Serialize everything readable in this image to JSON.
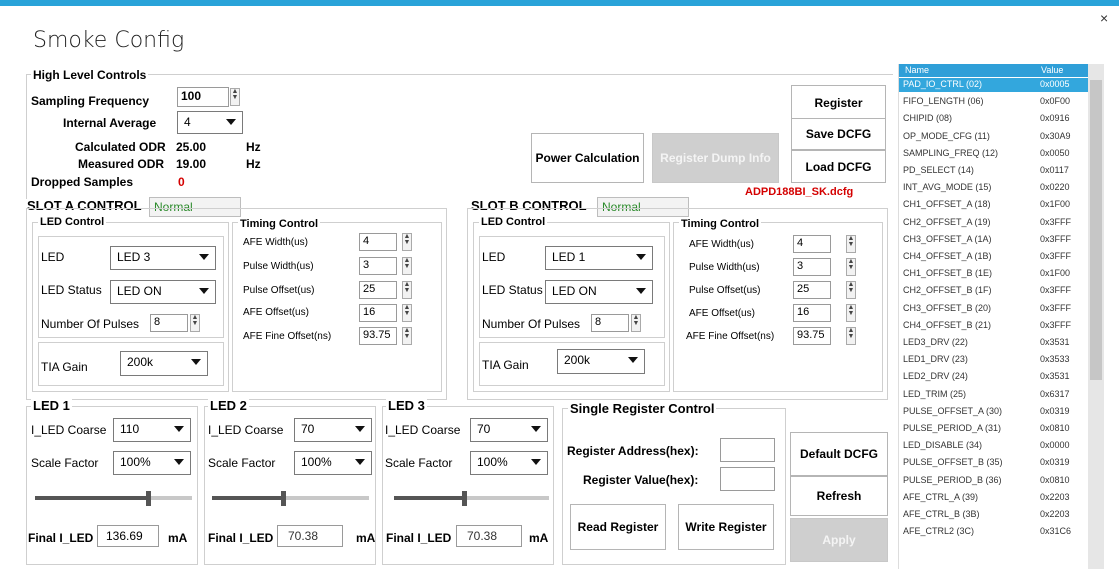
{
  "window": {
    "title": "Smoke Config",
    "close_glyph": "×",
    "accent_color": "#29a3d9"
  },
  "high_level": {
    "group_label": "High Level Controls",
    "sampling_frequency_label": "Sampling Frequency",
    "sampling_frequency_value": "100",
    "internal_average_label": "Internal Average",
    "internal_average_value": "4",
    "calculated_odr_label": "Calculated ODR",
    "calculated_odr_value": "25.00",
    "calculated_odr_unit": "Hz",
    "measured_odr_label": "Measured ODR",
    "measured_odr_value": "19.00",
    "measured_odr_unit": "Hz",
    "dropped_samples_label": "Dropped Samples",
    "dropped_samples_value": "0"
  },
  "buttons": {
    "power_calculation": "Power Calculation",
    "register_dump_info": "Register Dump Info",
    "register": "Register",
    "save_dcfg": "Save DCFG",
    "load_dcfg": "Load DCFG",
    "default_dcfg": "Default DCFG",
    "refresh": "Refresh",
    "apply": "Apply"
  },
  "dcfg_file": "ADPD188BI_SK.dcfg",
  "slot_a": {
    "title": "SLOT A CONTROL",
    "status": "Normal",
    "led_control_label": "LED Control",
    "led_label": "LED",
    "led_value": "LED 3",
    "led_status_label": "LED Status",
    "led_status_value": "LED ON",
    "pulses_label": "Number Of Pulses",
    "pulses_value": "8",
    "tia_gain_label": "TIA Gain",
    "tia_gain_value": "200k",
    "timing_label": "Timing Control",
    "afe_width_label": "AFE Width(us)",
    "afe_width_value": "4",
    "pulse_width_label": "Pulse Width(us)",
    "pulse_width_value": "3",
    "pulse_offset_label": "Pulse Offset(us)",
    "pulse_offset_value": "25",
    "afe_offset_label": "AFE Offset(us)",
    "afe_offset_value": "16",
    "afe_fine_offset_label": "AFE Fine Offset(ns)",
    "afe_fine_offset_value": "93.75"
  },
  "slot_b": {
    "title": "SLOT B CONTROL",
    "status": "Normal",
    "led_control_label": "LED Control",
    "led_label": "LED",
    "led_value": "LED 1",
    "led_status_label": "LED Status",
    "led_status_value": "LED ON",
    "pulses_label": "Number Of Pulses",
    "pulses_value": "8",
    "tia_gain_label": "TIA Gain",
    "tia_gain_value": "200k",
    "timing_label": "Timing Control",
    "afe_width_label": "AFE Width(us)",
    "afe_width_value": "4",
    "pulse_width_label": "Pulse Width(us)",
    "pulse_width_value": "3",
    "pulse_offset_label": "Pulse Offset(us)",
    "pulse_offset_value": "25",
    "afe_offset_label": "AFE Offset(us)",
    "afe_offset_value": "16",
    "afe_fine_offset_label": "AFE Fine Offset(ns)",
    "afe_fine_offset_value": "93.75"
  },
  "leds": [
    {
      "title": "LED 1",
      "coarse_label": "I_LED Coarse",
      "coarse_value": "110",
      "scale_label": "Scale Factor",
      "scale_value": "100%",
      "slider_fraction": 0.72,
      "final_label": "Final I_LED",
      "final_value": "136.69",
      "unit": "mA"
    },
    {
      "title": "LED 2",
      "coarse_label": "I_LED Coarse",
      "coarse_value": "70",
      "scale_label": "Scale Factor",
      "scale_value": "100%",
      "slider_fraction": 0.45,
      "final_label": "Final I_LED",
      "final_value": "70.38",
      "unit": "mA"
    },
    {
      "title": "LED 3",
      "coarse_label": "I_LED Coarse",
      "coarse_value": "70",
      "scale_label": "Scale Factor",
      "scale_value": "100%",
      "slider_fraction": 0.45,
      "final_label": "Final I_LED",
      "final_value": "70.38",
      "unit": "mA"
    }
  ],
  "single_register": {
    "title": "Single Register Control",
    "address_label": "Register Address(hex):",
    "address_value": "",
    "value_label": "Register Value(hex):",
    "value_value": "",
    "read_button": "Read Register",
    "write_button": "Write Register"
  },
  "register_table": {
    "name_header": "Name",
    "value_header": "Value",
    "rows": [
      {
        "name": "PAD_IO_CTRL (02)",
        "value": "0x0005"
      },
      {
        "name": "FIFO_LENGTH (06)",
        "value": "0x0F00"
      },
      {
        "name": "CHIPID (08)",
        "value": "0x0916"
      },
      {
        "name": "OP_MODE_CFG (11)",
        "value": "0x30A9"
      },
      {
        "name": "SAMPLING_FREQ (12)",
        "value": "0x0050"
      },
      {
        "name": "PD_SELECT (14)",
        "value": "0x0117"
      },
      {
        "name": "INT_AVG_MODE (15)",
        "value": "0x0220"
      },
      {
        "name": "CH1_OFFSET_A (18)",
        "value": "0x1F00"
      },
      {
        "name": "CH2_OFFSET_A (19)",
        "value": "0x3FFF"
      },
      {
        "name": "CH3_OFFSET_A (1A)",
        "value": "0x3FFF"
      },
      {
        "name": "CH4_OFFSET_A (1B)",
        "value": "0x3FFF"
      },
      {
        "name": "CH1_OFFSET_B (1E)",
        "value": "0x1F00"
      },
      {
        "name": "CH2_OFFSET_B (1F)",
        "value": "0x3FFF"
      },
      {
        "name": "CH3_OFFSET_B (20)",
        "value": "0x3FFF"
      },
      {
        "name": "CH4_OFFSET_B (21)",
        "value": "0x3FFF"
      },
      {
        "name": "LED3_DRV (22)",
        "value": "0x3531"
      },
      {
        "name": "LED1_DRV (23)",
        "value": "0x3533"
      },
      {
        "name": "LED2_DRV (24)",
        "value": "0x3531"
      },
      {
        "name": "LED_TRIM (25)",
        "value": "0x6317"
      },
      {
        "name": "PULSE_OFFSET_A (30)",
        "value": "0x0319"
      },
      {
        "name": "PULSE_PERIOD_A (31)",
        "value": "0x0810"
      },
      {
        "name": "LED_DISABLE (34)",
        "value": "0x0000"
      },
      {
        "name": "PULSE_OFFSET_B (35)",
        "value": "0x0319"
      },
      {
        "name": "PULSE_PERIOD_B (36)",
        "value": "0x0810"
      },
      {
        "name": "AFE_CTRL_A (39)",
        "value": "0x2203"
      },
      {
        "name": "AFE_CTRL_B (3B)",
        "value": "0x2203"
      },
      {
        "name": "AFE_CTRL2 (3C)",
        "value": "0x31C6"
      }
    ]
  }
}
